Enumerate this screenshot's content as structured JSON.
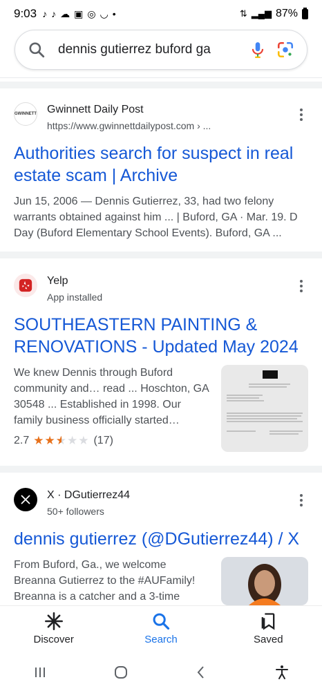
{
  "status": {
    "time": "9:03",
    "battery": "87%"
  },
  "search": {
    "query": "dennis gutierrez buford ga"
  },
  "results": [
    {
      "source": "Gwinnett Daily Post",
      "url": "https://www.gwinnettdailypost.com › ...",
      "favicon_text": "GWINNETT",
      "title": "Authorities search for suspect in real estate scam | Archive",
      "snippet": "Jun 15, 2006 — Dennis Gutierrez, 33, had two felony warrants obtained against him ... | Buford, GA · Mar. 19. D Day (Buford Elementary School Events). Buford, GA ..."
    },
    {
      "source": "Yelp",
      "url": "App installed",
      "title": "SOUTHEASTERN PAINTING & RENOVATIONS - Updated May 2024",
      "snippet": "We knew Dennis through Buford community and… read ... Hoschton, GA 30548 ... Established in 1998. Our family business officially started…",
      "rating": "2.7",
      "stars_value": 2.5,
      "reviews": "(17)"
    },
    {
      "source": "X · DGutierrez44",
      "url": "50+ followers",
      "title": "dennis gutierrez (@DGutierrez44) / X",
      "snippet": "From Buford, Ga., we welcome Breanna Gutierrez to the #AUFamily! Breanna is a catcher and a 3-time"
    }
  ],
  "bottom_nav": {
    "discover": "Discover",
    "search": "Search",
    "saved": "Saved"
  },
  "colors": {
    "link": "#1558d6",
    "accent": "#1a73e8",
    "yelp": "#d32323",
    "star": "#e7711b"
  }
}
